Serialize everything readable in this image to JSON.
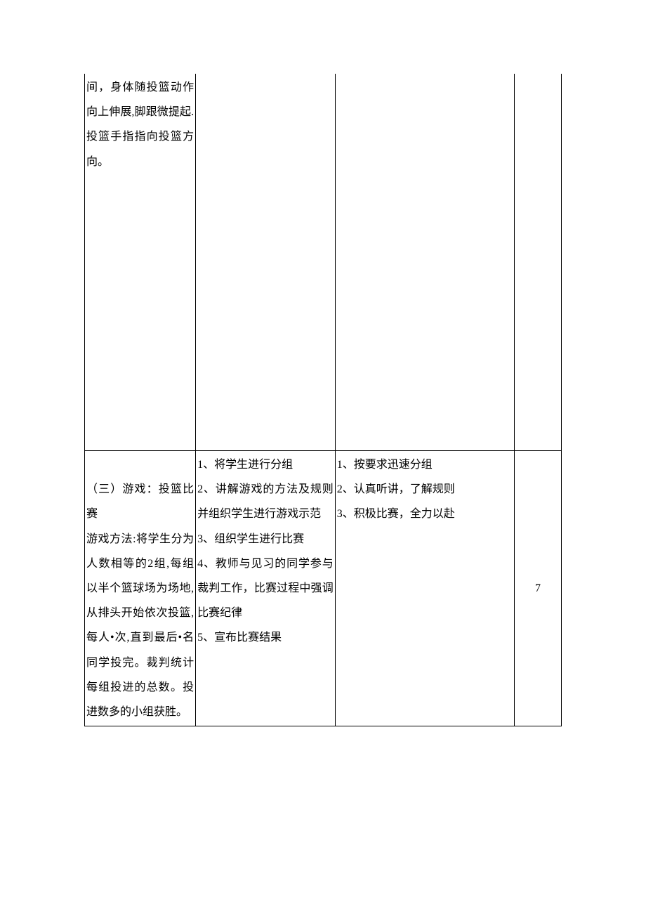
{
  "row1": {
    "col1": "间，身体随投篮动作向上伸展,脚跟微提起.投篮手指指向投篮方向。"
  },
  "row2": {
    "col1_title": "（三）游戏：投篮比赛",
    "col1_body": "游戏方法:将学生分为人数相等的2组,每组以半个篮球场为场地,从排头开始依次投篮,每人•次,直到最后•名同学投完。裁判统计每组投进的总数。投进数多的小组获胜。",
    "col2_lines": [
      "1、将学生进行分组",
      "2、讲解游戏的方法及规则并组织学生进行游戏示范",
      "3、组织学生进行比赛",
      "4、教师与见习的同学参与裁判工作，比赛过程中强调比赛纪律",
      "5、宣布比赛结果"
    ],
    "col3_lines": [
      "1、按要求迅速分组",
      "2、认真听讲，了解规则",
      "3、积极比赛，全力以赴"
    ],
    "col4": "7"
  }
}
